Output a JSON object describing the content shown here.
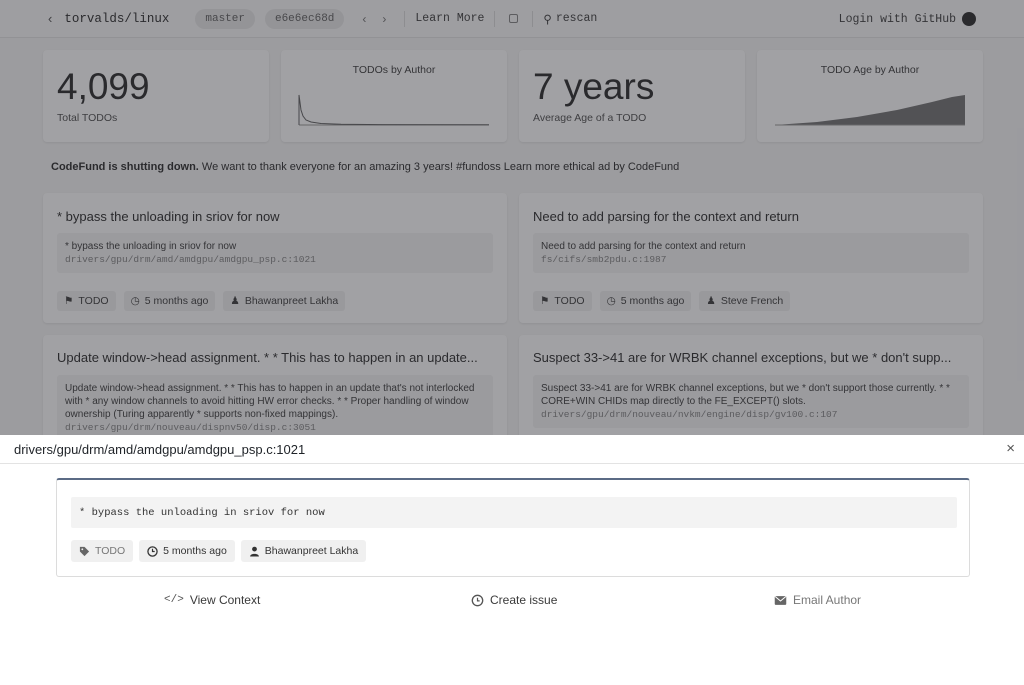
{
  "background": {
    "topbar": {
      "back_icon": "chevron-left-icon",
      "repo": "torvalds/linux",
      "branch": "master",
      "commit": "e6e6ec68d",
      "prev_icon": "chevron-left-icon",
      "next_icon": "chevron-right-icon",
      "learn_more": "Learn More",
      "rescan": "rescan",
      "login": "Login with GitHub"
    },
    "stats": {
      "total_todos_value": "4,099",
      "total_todos_label": "Total TODOs",
      "todos_by_author_title": "TODOs by Author",
      "average_age_value": "7 years",
      "average_age_label": "Average Age of a TODO",
      "todo_age_by_author_title": "TODO Age by Author"
    },
    "notice": {
      "bold": "CodeFund is shutting down.",
      "text": " We want to thank everyone for an amazing 3 years! #fundoss Learn more ethical ad by CodeFund"
    },
    "cards": [
      {
        "title": "* bypass the unloading in sriov for now",
        "body": "* bypass the unloading in sriov for now",
        "path": "drivers/gpu/drm/amd/amdgpu/amdgpu_psp.c:1021",
        "tag": "TODO",
        "age": "5 months ago",
        "author": "Bhawanpreet Lakha"
      },
      {
        "title": "Need to add parsing for the context and return",
        "body": "Need to add parsing for the context and return",
        "path": "fs/cifs/smb2pdu.c:1987",
        "tag": "TODO",
        "age": "5 months ago",
        "author": "Steve French"
      },
      {
        "title": "Update window->head assignment. * * This has to happen in an update...",
        "body": "Update window->head assignment. * * This has to happen in an update that's not interlocked with * any window channels to avoid hitting HW error checks. * * Proper handling of window ownership (Turing apparently * supports non-fixed mappings).",
        "path": "drivers/gpu/drm/nouveau/dispnv50/disp.c:3051"
      },
      {
        "title": "Suspect 33->41 are for WRBK channel exceptions, but we * don't supp...",
        "body": "Suspect 33->41 are for WRBK channel exceptions, but we * don't support those currently. * * CORE+WIN CHIDs map directly to the FE_EXCEPT() slots.",
        "path": "drivers/gpu/drm/nouveau/nvkm/engine/disp/gv100.c:107"
      }
    ]
  },
  "modal": {
    "title": "drivers/gpu/drm/amd/amdgpu/amdgpu_psp.c:1021",
    "close_icon": "close-icon",
    "code": "* bypass the unloading in sriov for now",
    "tags": {
      "todo": "TODO",
      "age": "5 months ago",
      "author": "Bhawanpreet Lakha"
    },
    "actions": {
      "view_context": "View Context",
      "create_issue": "Create issue",
      "email_author": "Email Author"
    }
  }
}
